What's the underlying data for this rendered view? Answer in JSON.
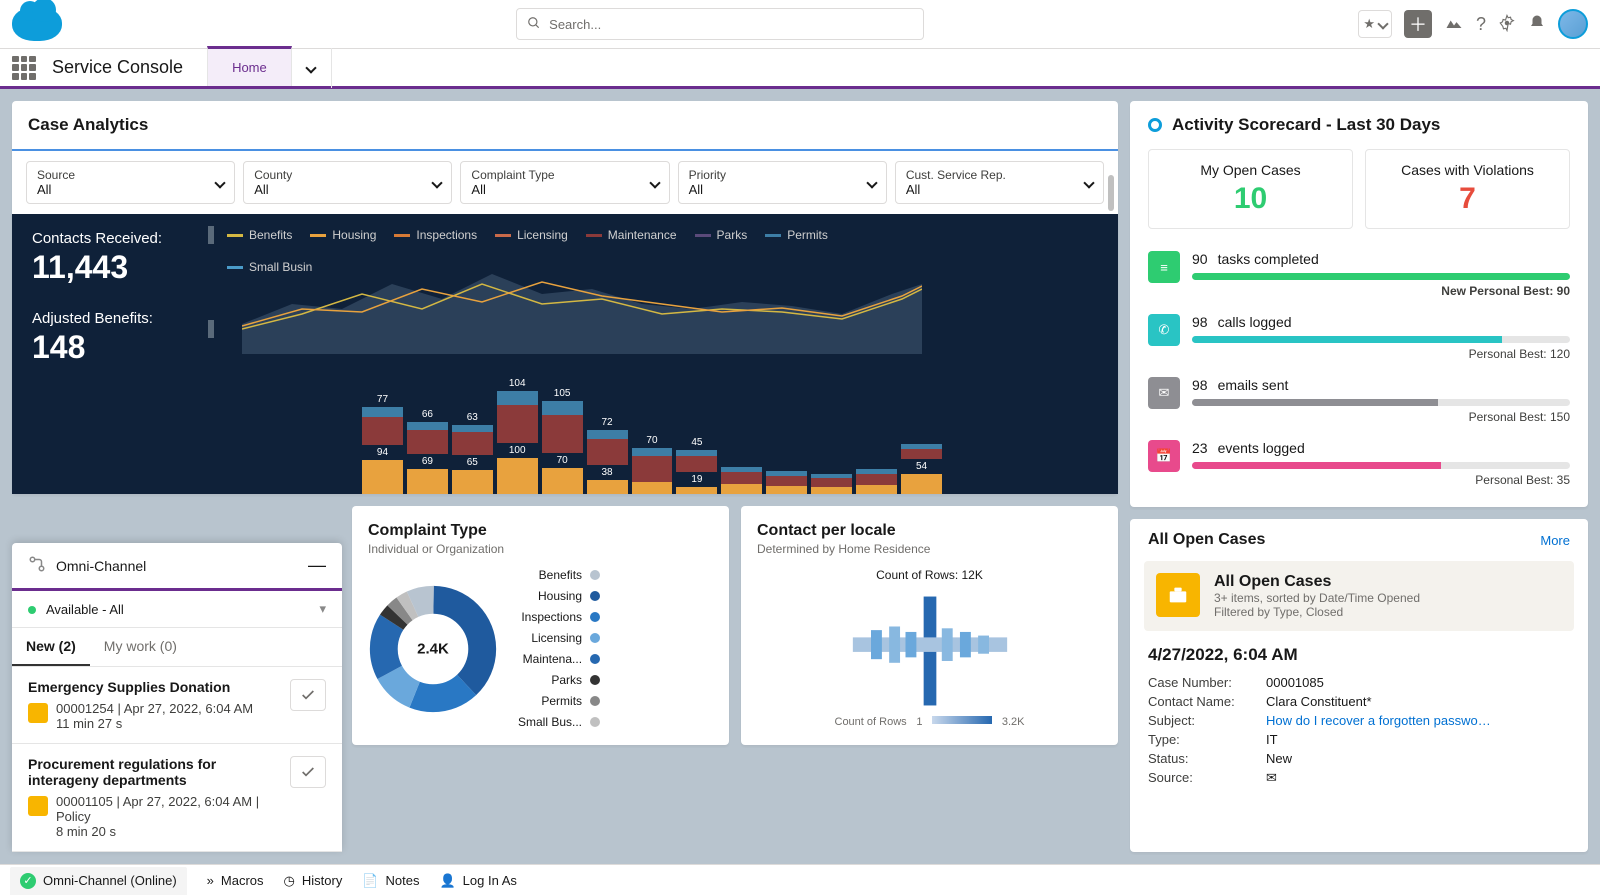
{
  "header": {
    "search_placeholder": "Search...",
    "app_name": "Service Console",
    "tab": "Home"
  },
  "case_analytics": {
    "title": "Case Analytics",
    "filters": [
      {
        "label": "Source",
        "value": "All"
      },
      {
        "label": "County",
        "value": "All"
      },
      {
        "label": "Complaint Type",
        "value": "All"
      },
      {
        "label": "Priority",
        "value": "All"
      },
      {
        "label": "Cust. Service Rep.",
        "value": "All"
      }
    ],
    "contacts_received_label": "Contacts Received:",
    "contacts_received": "11,443",
    "adjusted_benefits_label": "Adjusted Benefits:",
    "adjusted_benefits": "148",
    "legend": [
      {
        "name": "Benefits",
        "color": "#d4b843"
      },
      {
        "name": "Housing",
        "color": "#e8a23e"
      },
      {
        "name": "Inspections",
        "color": "#d67a36"
      },
      {
        "name": "Licensing",
        "color": "#c96a4a"
      },
      {
        "name": "Maintenance",
        "color": "#8b3a3a"
      },
      {
        "name": "Parks",
        "color": "#5a4a7a"
      },
      {
        "name": "Permits",
        "color": "#3d7ea6"
      },
      {
        "name": "Small Busin",
        "color": "#4a9bc9"
      }
    ],
    "bars": [
      {
        "top": "77",
        "bottom": "94",
        "h1": 28,
        "h2": 34,
        "h3": 10
      },
      {
        "top": "66",
        "bottom": "69",
        "h1": 24,
        "h2": 25,
        "h3": 8
      },
      {
        "top": "63",
        "bottom": "65",
        "h1": 23,
        "h2": 24,
        "h3": 7
      },
      {
        "top": "104",
        "bottom": "100",
        "h1": 38,
        "h2": 36,
        "h3": 14
      },
      {
        "top": "105",
        "bottom": "70",
        "h1": 38,
        "h2": 26,
        "h3": 14
      },
      {
        "top": "72",
        "bottom": "38",
        "h1": 26,
        "h2": 14,
        "h3": 9
      },
      {
        "top": "70",
        "bottom": "",
        "h1": 26,
        "h2": 12,
        "h3": 8
      },
      {
        "top": "45",
        "bottom": "19",
        "h1": 16,
        "h2": 7,
        "h3": 6
      },
      {
        "top": "",
        "bottom": "",
        "h1": 12,
        "h2": 10,
        "h3": 5
      },
      {
        "top": "",
        "bottom": "",
        "h1": 10,
        "h2": 8,
        "h3": 5
      },
      {
        "top": "",
        "bottom": "",
        "h1": 9,
        "h2": 7,
        "h3": 4
      },
      {
        "top": "",
        "bottom": "",
        "h1": 11,
        "h2": 9,
        "h3": 5
      },
      {
        "top": "",
        "bottom": "54",
        "h1": 10,
        "h2": 20,
        "h3": 5
      }
    ]
  },
  "complaint_type": {
    "title": "Complaint Type",
    "sub": "Individual or Organization",
    "center": "2.4K",
    "items": [
      {
        "name": "Benefits",
        "color": "#b8c4d0"
      },
      {
        "name": "Housing",
        "color": "#1f5a9e"
      },
      {
        "name": "Inspections",
        "color": "#2978c4"
      },
      {
        "name": "Licensing",
        "color": "#6aa8dc"
      },
      {
        "name": "Maintena...",
        "color": "#2668b0"
      },
      {
        "name": "Parks",
        "color": "#333"
      },
      {
        "name": "Permits",
        "color": "#888"
      },
      {
        "name": "Small Bus...",
        "color": "#c0c0c0"
      }
    ]
  },
  "contact_locale": {
    "title": "Contact per locale",
    "sub": "Determined by Home Residence",
    "count_label": "Count of Rows: 12K",
    "axis": "Count of Rows",
    "axis_min": "1",
    "axis_max": "3.2K"
  },
  "omni": {
    "title": "Omni-Channel",
    "status": "Available - All",
    "tab_new": "New (2)",
    "tab_mywork": "My work (0)",
    "items": [
      {
        "title": "Emergency Supplies Donation",
        "id": "00001254",
        "ts": "Apr 27, 2022, 6:04 AM",
        "elapsed": "11 min 27 s",
        "extra": ""
      },
      {
        "title": "Procurement regulations for interageny departments",
        "id": "00001105",
        "ts": "Apr 27, 2022, 6:04 AM",
        "elapsed": "8 min 20 s",
        "extra": "Policy"
      }
    ]
  },
  "scorecard": {
    "title": "Activity Scorecard - Last 30 Days",
    "kpis": [
      {
        "label": "My Open Cases",
        "value": "10",
        "color": "#2ecc71"
      },
      {
        "label": "Cases with Violations",
        "value": "7",
        "color": "#e74c3c"
      }
    ],
    "items": [
      {
        "n": "90",
        "label": "tasks completed",
        "pct": 100,
        "color": "#2ecc71",
        "icon": "#2ecc71",
        "best": "New Personal Best: 90",
        "bold": true
      },
      {
        "n": "98",
        "label": "calls logged",
        "pct": 82,
        "color": "#29c4c4",
        "icon": "#29c4c4",
        "best": "Personal Best: 120"
      },
      {
        "n": "98",
        "label": "emails sent",
        "pct": 65,
        "color": "#8e8e93",
        "icon": "#8e8e93",
        "best": "Personal Best: 150"
      },
      {
        "n": "23",
        "label": "events logged",
        "pct": 66,
        "color": "#e84a8c",
        "icon": "#e84a8c",
        "best": "Personal Best: 35"
      }
    ]
  },
  "open_cases": {
    "heading": "All Open Cases",
    "more": "More",
    "banner_title": "All Open Cases",
    "banner_line1": "3+ items, sorted by Date/Time Opened",
    "banner_line2": "Filtered by Type, Closed",
    "time": "4/27/2022, 6:04 AM",
    "rows": [
      {
        "label": "Case Number:",
        "value": "00001085"
      },
      {
        "label": "Contact Name:",
        "value": "Clara Constituent*"
      },
      {
        "label": "Subject:",
        "value": "How do I recover a forgotten passwo…",
        "link": true
      },
      {
        "label": "Type:",
        "value": "IT"
      },
      {
        "label": "Status:",
        "value": "New"
      },
      {
        "label": "Source:",
        "value": "✉"
      }
    ]
  },
  "footer": {
    "omni": "Omni-Channel (Online)",
    "macros": "Macros",
    "history": "History",
    "notes": "Notes",
    "login": "Log In As"
  },
  "chart_data": {
    "contacts_bars": {
      "type": "bar",
      "title": "Contacts Received stacked bars",
      "series_colors": [
        "#8b3a3a",
        "#e8a23e",
        "#3d7ea6"
      ],
      "labels_top": [
        "77",
        "66",
        "63",
        "104",
        "105",
        "72",
        "70",
        "45",
        "",
        "",
        "",
        "",
        ""
      ],
      "labels_bottom": [
        "94",
        "69",
        "65",
        "100",
        "70",
        "38",
        "",
        "19",
        "",
        "",
        "",
        "",
        "54"
      ]
    },
    "complaint_donut": {
      "type": "pie",
      "total": "2.4K",
      "categories": [
        "Benefits",
        "Housing",
        "Inspections",
        "Licensing",
        "Maintenance",
        "Parks",
        "Permits",
        "Small Business"
      ],
      "values": [
        180,
        900,
        420,
        260,
        400,
        80,
        80,
        80
      ]
    }
  }
}
